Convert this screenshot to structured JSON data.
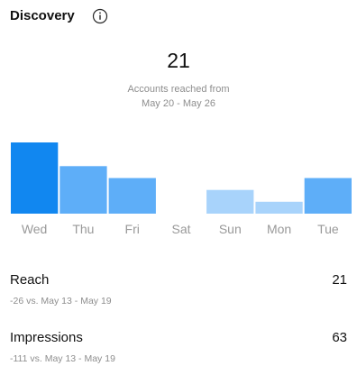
{
  "header": {
    "title": "Discovery",
    "info_icon": "info-circle-icon"
  },
  "summary": {
    "total": "21",
    "line1": "Accounts reached from",
    "line2": "May 20 - May 26"
  },
  "chart_data": {
    "type": "bar",
    "categories": [
      "Wed",
      "Thu",
      "Fri",
      "Sat",
      "Sun",
      "Mon",
      "Tue"
    ],
    "values": [
      6,
      4,
      3,
      0,
      2,
      1,
      3
    ],
    "bar_colors": [
      "#1187f0",
      "#5eaef8",
      "#5eaef8",
      "#5eaef8",
      "#a8d3fb",
      "#a8d3fb",
      "#5eaef8"
    ],
    "grid": false,
    "legend": "none"
  },
  "metrics": [
    {
      "label": "Reach",
      "value": "21",
      "comparison": "-26 vs. May 13 - May 19"
    },
    {
      "label": "Impressions",
      "value": "63",
      "comparison": "-111 vs. May 13 - May 19"
    }
  ],
  "colors": {
    "accent": "#1187f0",
    "muted_text": "#8e8e8e",
    "axis_text": "#999999"
  }
}
